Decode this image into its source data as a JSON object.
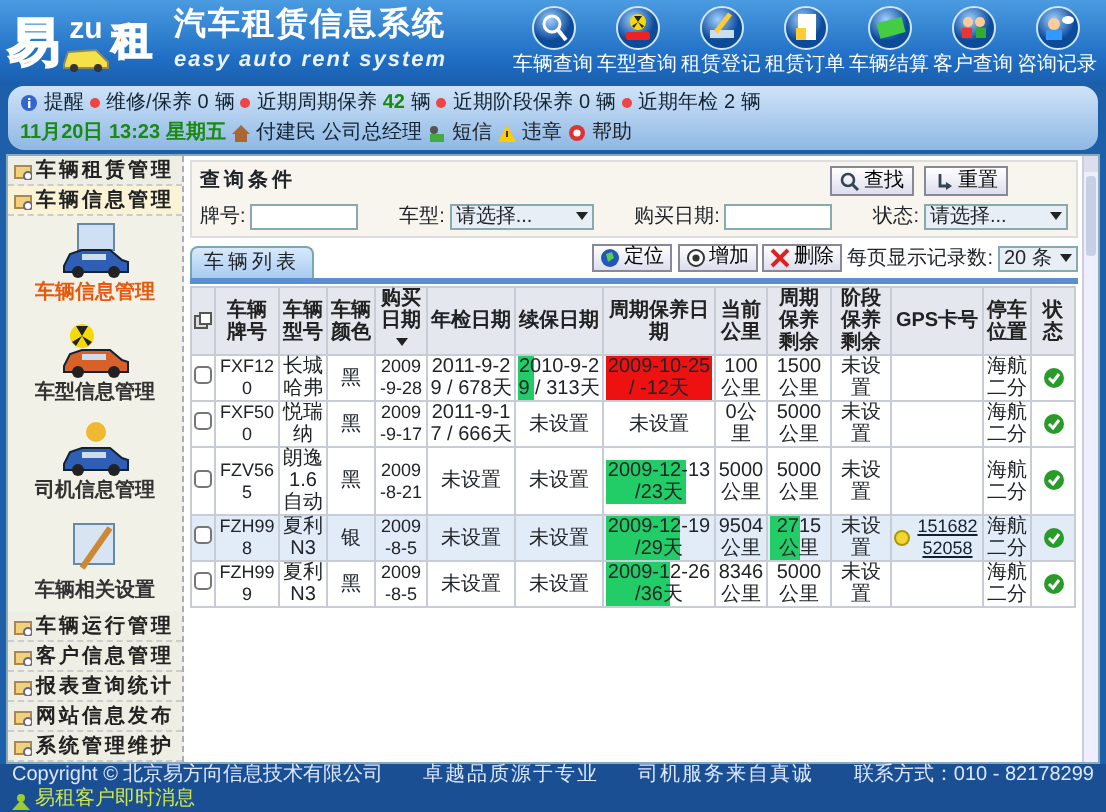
{
  "header": {
    "logo": [
      "易",
      "zu",
      "租"
    ],
    "title": "汽车租赁信息系统",
    "subtitle": "easy auto rent system",
    "nav": [
      {
        "label": "车辆查询",
        "kind": "magnifier"
      },
      {
        "label": "车型查询",
        "kind": "radiation"
      },
      {
        "label": "租赁登记",
        "kind": "pen"
      },
      {
        "label": "租赁订单",
        "kind": "document"
      },
      {
        "label": "车辆结算",
        "kind": "money"
      },
      {
        "label": "客户查询",
        "kind": "people"
      },
      {
        "label": "咨询记录",
        "kind": "chat"
      }
    ]
  },
  "info_bar": {
    "reminder": "提醒",
    "counts": [
      {
        "label": "维修/保养",
        "count": "0",
        "unit": "辆",
        "highlight": false
      },
      {
        "label": "近期周期保养",
        "count": "42",
        "unit": "辆",
        "highlight": true
      },
      {
        "label": "近期阶段保养",
        "count": "0",
        "unit": "辆",
        "highlight": false
      },
      {
        "label": "近期年检",
        "count": "2",
        "unit": "辆",
        "highlight": false
      }
    ],
    "date": "11月20日 13:23",
    "weekday": "星期五",
    "user": "付建民",
    "role": "公司总经理",
    "links": [
      {
        "label": "短信",
        "kind": "sms"
      },
      {
        "label": "违章",
        "kind": "warning"
      },
      {
        "label": "帮助",
        "kind": "help"
      }
    ]
  },
  "sidebar": {
    "top_items": [
      {
        "label": "车辆租赁管理",
        "selected": false
      },
      {
        "label": "车辆信息管理",
        "selected": true
      }
    ],
    "modules": [
      {
        "label": "车辆信息管理",
        "kind": "car",
        "selected": true
      },
      {
        "label": "车型信息管理",
        "kind": "radiation",
        "selected": false
      },
      {
        "label": "司机信息管理",
        "kind": "driver",
        "selected": false
      },
      {
        "label": "车辆相关设置",
        "kind": "settings",
        "selected": false
      }
    ],
    "bottom_items": [
      {
        "label": "车辆运行管理",
        "selected": false
      },
      {
        "label": "客户信息管理",
        "selected": false
      },
      {
        "label": "报表查询统计",
        "selected": false
      },
      {
        "label": "网站信息发布",
        "selected": false
      },
      {
        "label": "系统管理维护",
        "selected": false
      }
    ]
  },
  "query": {
    "title": "查询条件",
    "fields": [
      {
        "label": "牌号:",
        "kind": "text"
      },
      {
        "label": "车型:",
        "kind": "select",
        "value": "请选择..."
      },
      {
        "label": "购买日期:",
        "kind": "text"
      },
      {
        "label": "状态:",
        "kind": "select",
        "value": "请选择..."
      }
    ],
    "buttons": [
      "查找",
      "重置"
    ]
  },
  "list": {
    "tab": "车辆列表",
    "actions": [
      {
        "label": "定位",
        "kind": "locate"
      },
      {
        "label": "增加",
        "kind": "add"
      },
      {
        "label": "删除",
        "kind": "delete"
      }
    ],
    "page_size_label": "每页显示记录数:",
    "page_size": "20 条",
    "columns": [
      {
        "kind": "icon",
        "sorted": false
      },
      {
        "label": "车辆牌号",
        "kind": "text",
        "sorted": false
      },
      {
        "label": "车辆型号",
        "kind": "text",
        "sorted": false
      },
      {
        "label": "车辆颜色",
        "kind": "text",
        "sorted": false
      },
      {
        "label": "购买日期",
        "kind": "text",
        "sorted": true
      },
      {
        "label": "年检日期",
        "kind": "text",
        "sorted": false
      },
      {
        "label": "续保日期",
        "kind": "text",
        "sorted": false
      },
      {
        "label": "周期保养日期",
        "kind": "text",
        "sorted": false
      },
      {
        "label": "当前公里",
        "kind": "text",
        "sorted": false
      },
      {
        "label": "周期保养剩余",
        "kind": "text",
        "sorted": false
      },
      {
        "label": "阶段保养剩余",
        "kind": "text",
        "sorted": false
      },
      {
        "label": "GPS卡号",
        "kind": "text",
        "sorted": false
      },
      {
        "label": "停车位置",
        "kind": "text",
        "sorted": false
      },
      {
        "label": "状态",
        "kind": "text",
        "sorted": false
      }
    ],
    "rows": [
      {
        "selected": false,
        "checked": false,
        "plate": "FXF120",
        "model": "长城哈弗",
        "color_name": "黑",
        "bought": "2009-9-28",
        "inspection": {
          "text": "2011-9-29 / 678天"
        },
        "insurance": {
          "text": "2010-9-29 / 313天",
          "color": "#22cc66",
          "level": 0.2
        },
        "service": {
          "text": "2009-10-25 / -12天",
          "color": "#ee1111",
          "level": 1
        },
        "km": "100公里",
        "service_left": {
          "text": "1500 公里"
        },
        "stage_left": "未设置",
        "gps": null,
        "parking": "海航二分",
        "active": true
      },
      {
        "selected": false,
        "checked": false,
        "plate": "FXF500",
        "model": "悦瑞纳",
        "color_name": "黑",
        "bought": "2009-9-17",
        "inspection": {
          "text": "2011-9-17 / 666天"
        },
        "insurance": {
          "text": "未设置"
        },
        "service": {
          "text": "未设置"
        },
        "km": "0公里",
        "service_left": {
          "text": "5000 公里"
        },
        "stage_left": "未设置",
        "gps": null,
        "parking": "海航二分",
        "active": true
      },
      {
        "selected": false,
        "checked": false,
        "plate": "FZV565",
        "model": "朗逸1.6自动",
        "color_name": "黑",
        "bought": "2009-8-21",
        "inspection": {
          "text": "未设置"
        },
        "insurance": {
          "text": "未设置"
        },
        "service": {
          "text": "2009-12-13 /23天",
          "color": "#22cc66",
          "level": 0.75
        },
        "km": "5000公里",
        "service_left": {
          "text": "5000 公里"
        },
        "stage_left": "未设置",
        "gps": null,
        "parking": "海航二分",
        "active": true
      },
      {
        "selected": true,
        "checked": false,
        "plate": "FZH998",
        "model": "夏利N3",
        "color_name": "银",
        "bought": "2009-8-5",
        "inspection": {
          "text": "未设置"
        },
        "insurance": {
          "text": "未设置"
        },
        "service": {
          "text": "2009-12-19 /29天",
          "color": "#22cc66",
          "level": 0.7
        },
        "km": "9504公里",
        "service_left": {
          "text": "2715 公里",
          "color": "#22cc66",
          "level": 0.5
        },
        "stage_left": "未设置",
        "gps": "15168252058",
        "parking": "海航二分",
        "active": true
      },
      {
        "selected": false,
        "checked": false,
        "plate": "FZH999",
        "model": "夏利N3",
        "color_name": "黑",
        "bought": "2009-8-5",
        "inspection": {
          "text": "未设置"
        },
        "insurance": {
          "text": "未设置"
        },
        "service": {
          "text": "2009-12-26 /36天",
          "color": "#22cc66",
          "level": 0.6
        },
        "km": "8346公里",
        "service_left": {
          "text": "5000 公里"
        },
        "stage_left": "未设置",
        "gps": null,
        "parking": "海航二分",
        "active": true
      }
    ]
  },
  "footer": {
    "copyright": "Copyright © 北京易方向信息技术有限公司",
    "slogans": [
      "卓越品质源于专业",
      "司机服务来自真诚"
    ],
    "contact": "联系方式：010 - 82178299",
    "messenger": "易租客户即时消息"
  }
}
